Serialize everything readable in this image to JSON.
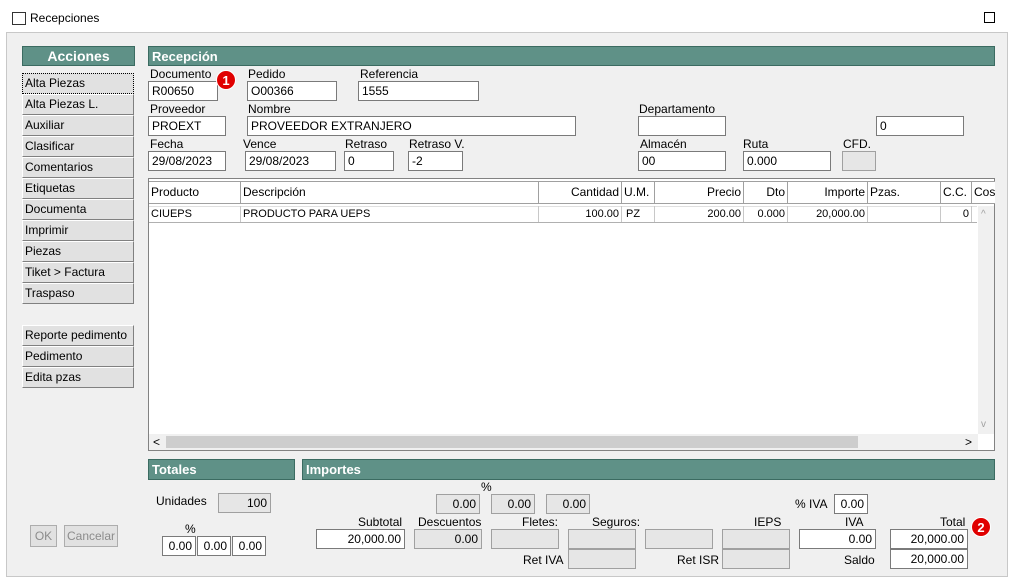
{
  "window": {
    "title": "Recepciones"
  },
  "sidebar": {
    "header": "Acciones",
    "group1": [
      "Alta Piezas",
      "Alta Piezas L.",
      "Auxiliar",
      "Clasificar",
      "Comentarios",
      "Etiquetas",
      "Documenta",
      "Imprimir",
      "Piezas",
      "Tiket > Factura",
      "Traspaso"
    ],
    "group2": [
      "Reporte pedimento",
      "Pedimento",
      "Edita pzas"
    ],
    "ok_label": "OK",
    "cancel_label": "Cancelar"
  },
  "recepcion": {
    "header": "Recepción",
    "documento": {
      "label": "Documento",
      "value": "R00650"
    },
    "pedido": {
      "label": "Pedido",
      "value": "O00366"
    },
    "referencia": {
      "label": "Referencia",
      "value": "1555"
    },
    "proveedor": {
      "label": "Proveedor",
      "value": "PROEXT"
    },
    "nombre": {
      "label": "Nombre",
      "value": "PROVEEDOR EXTRANJERO"
    },
    "departamento": {
      "label": "Departamento",
      "value": "",
      "extra_value": "0"
    },
    "fecha": {
      "label": "Fecha",
      "value": "29/08/2023"
    },
    "vence": {
      "label": "Vence",
      "value": "29/08/2023"
    },
    "retraso": {
      "label": "Retraso",
      "value": "0"
    },
    "retraso_v": {
      "label": "Retraso V.",
      "value": "-2"
    },
    "almacen": {
      "label": "Almacén",
      "value": "00"
    },
    "ruta": {
      "label": "Ruta",
      "value": "0.000"
    },
    "cfd": {
      "label": "CFD.",
      "value": ""
    }
  },
  "grid": {
    "columns": [
      "Producto",
      "Descripción",
      "Cantidad",
      "U.M.",
      "Precio",
      "Dto",
      "Importe",
      "Pzas.",
      "C.C.",
      "Cos"
    ],
    "rows": [
      {
        "producto": "CIUEPS",
        "descripcion": "PRODUCTO PARA UEPS",
        "cantidad": "100.00",
        "um": "PZ",
        "precio": "200.00",
        "dto": "0.000",
        "importe": "20,000.00",
        "pzas": "",
        "cc": "0"
      }
    ],
    "scroll_left": "<",
    "scroll_right": ">",
    "scroll_up": "^",
    "scroll_down": "v"
  },
  "totales": {
    "header": "Totales",
    "unidades_label": "Unidades",
    "unidades_value": "100",
    "pct_label": "%",
    "pct_values": [
      "0.00",
      "0.00",
      "0.00"
    ]
  },
  "importes": {
    "header": "Importes",
    "pct_label": "%",
    "pct_values": [
      "0.00",
      "0.00",
      "0.00"
    ],
    "iva_pct_label": "% IVA",
    "iva_pct_value": "0.00",
    "subtotal": {
      "label": "Subtotal",
      "value": "20,000.00"
    },
    "descuentos": {
      "label": "Descuentos",
      "value": "0.00"
    },
    "fletes": {
      "label": "Fletes:",
      "value": ""
    },
    "seguros": {
      "label": "Seguros:",
      "value": ""
    },
    "ieps": {
      "label": "IEPS",
      "value": ""
    },
    "iva": {
      "label": "IVA",
      "value": "0.00"
    },
    "total": {
      "label": "Total",
      "value": "20,000.00"
    },
    "ret_iva": {
      "label": "Ret IVA",
      "value": ""
    },
    "ret_isr": {
      "label": "Ret ISR",
      "value": ""
    },
    "saldo": {
      "label": "Saldo",
      "value": "20,000.00"
    }
  },
  "badges": [
    "1",
    "2"
  ]
}
